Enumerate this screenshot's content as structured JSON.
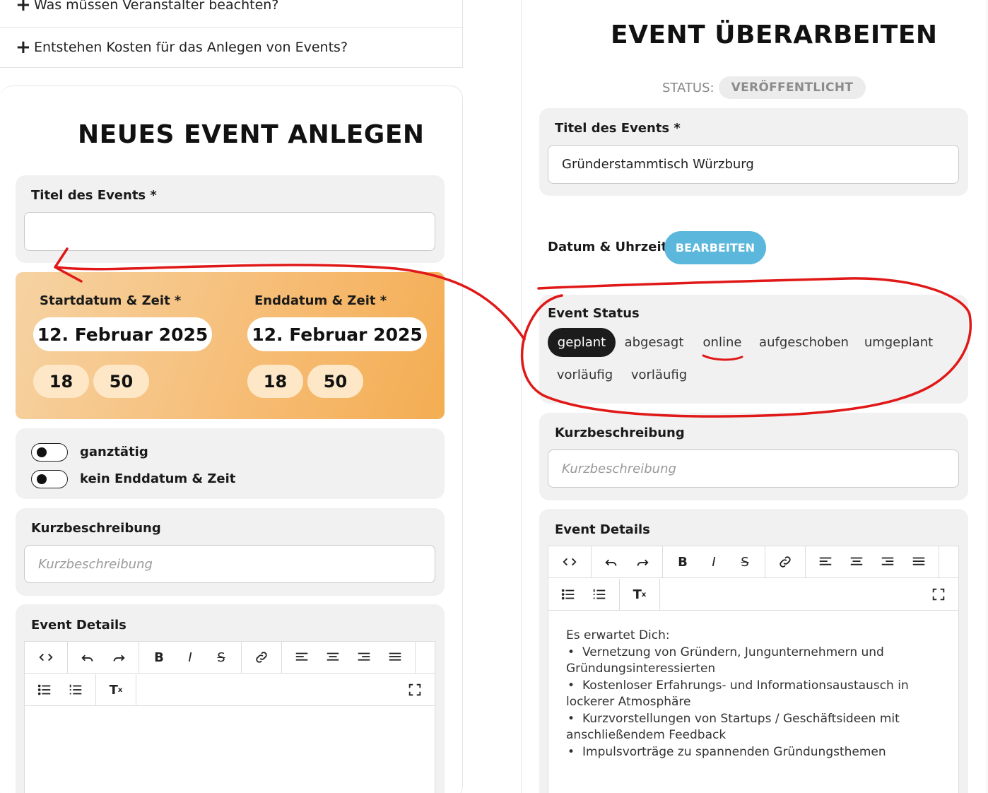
{
  "faq": {
    "items": [
      {
        "label": "Was müssen Veranstalter beachten?"
      },
      {
        "label": "Entstehen Kosten für das Anlegen von Events?"
      }
    ]
  },
  "new_event": {
    "title": "NEUES EVENT ANLEGEN",
    "title_label": "Titel des Events *",
    "title_value": "",
    "start_label": "Startdatum & Zeit *",
    "end_label": "Enddatum & Zeit *",
    "start_date": "12. Februar 2025",
    "start_hour": "18",
    "start_minute": "50",
    "end_date": "12. Februar 2025",
    "end_hour": "18",
    "end_minute": "50",
    "toggle_allday": "ganztätig",
    "toggle_noend": "kein Enddatum & Zeit",
    "short_label": "Kurzbeschreibung",
    "short_placeholder": "Kurzbeschreibung",
    "details_label": "Event Details"
  },
  "edit_event": {
    "title": "EVENT ÜBERARBEITEN",
    "status_label": "STATUS:",
    "status_value": "VERÖFFENTLICHT",
    "title_label": "Titel des Events *",
    "title_value": "Gründerstammtisch Würzburg",
    "datetime_label": "Datum & Uhrzeit",
    "edit_button": "BEARBEITEN",
    "event_status_label": "Event Status",
    "status_options": [
      "geplant",
      "abgesagt",
      "online",
      "aufgeschoben",
      "umgeplant",
      "vorläufig",
      "vorläufig"
    ],
    "selected_status": "geplant",
    "short_label": "Kurzbeschreibung",
    "short_placeholder": "Kurzbeschreibung",
    "details_label": "Event Details",
    "content_intro": "Es erwartet Dich:",
    "content_items": [
      "Vernetzung von Gründern, Jungunternehmern und Gründungsinteressierten",
      "Kostenloser Erfahrungs- und Informationsaustausch in lockerer Atmosphäre",
      "Kurzvorstellungen von Startups / Geschäftsideen mit anschließendem Feedback",
      "Impulsvorträge zu spannenden Gründungsthemen"
    ]
  },
  "colors": {
    "accent_blue": "#5cb7dc",
    "annotation_red": "#e01818",
    "date_card_orange": "#f6bd76"
  }
}
